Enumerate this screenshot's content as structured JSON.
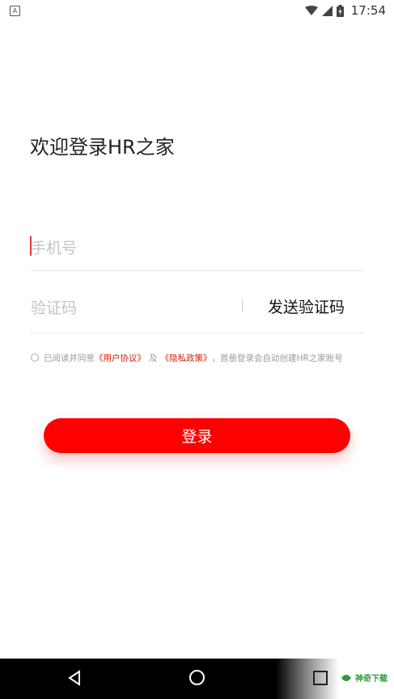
{
  "status_bar": {
    "notification_icon": "A",
    "time": "17:54"
  },
  "title": "欢迎登录HR之家",
  "form": {
    "phone_placeholder": "手机号",
    "code_placeholder": "验证码",
    "send_code_label": "发送验证码"
  },
  "agreement": {
    "prefix": "已阅读并同意",
    "user_agreement": "《用户协议》",
    "and": "及",
    "privacy_policy": "《隐私政策》",
    "suffix": "，首册登录会自动创建HR之家账号"
  },
  "login_button": "登录",
  "watermark": "神奇下载",
  "colors": {
    "accent": "#ff0000",
    "link": "#d81e06",
    "placeholder": "#c4c4c4"
  }
}
